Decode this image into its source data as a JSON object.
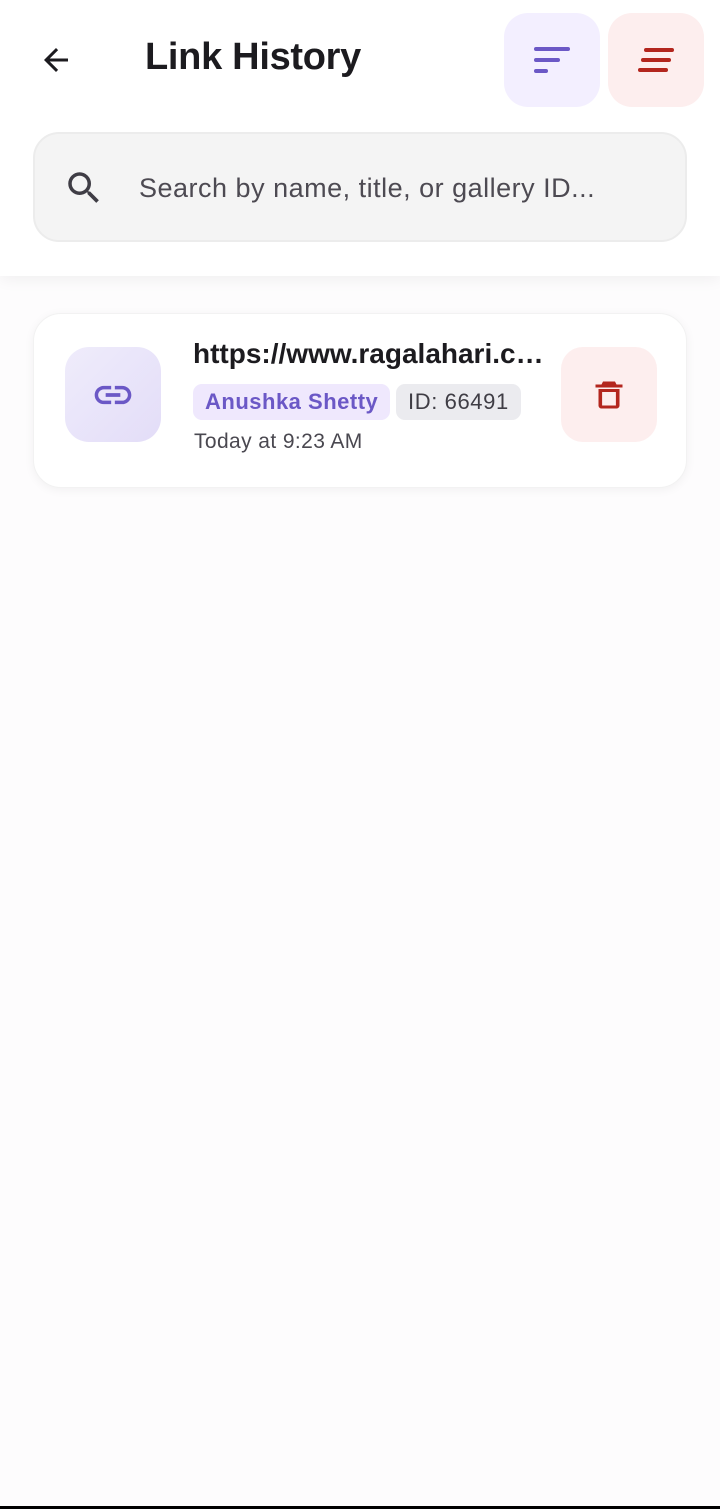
{
  "header": {
    "title": "Link History",
    "back_icon": "arrow-left-icon",
    "sort_icon": "sort-icon",
    "clear_icon": "clear-all-icon"
  },
  "search": {
    "placeholder": "Search by name, title, or gallery ID...",
    "value": "",
    "icon": "search-icon"
  },
  "history": {
    "items": [
      {
        "url": "https://www.ragalahari.com/actress/...",
        "name_tag": "Anushka Shetty",
        "id_tag": "ID: 66491",
        "timestamp": "Today at 9:23 AM",
        "icon": "link-icon",
        "delete_icon": "delete-icon"
      }
    ]
  },
  "colors": {
    "accent_purple": "#6b58c6",
    "danger_red": "#b3261e",
    "text_primary": "#1c1b1f"
  }
}
